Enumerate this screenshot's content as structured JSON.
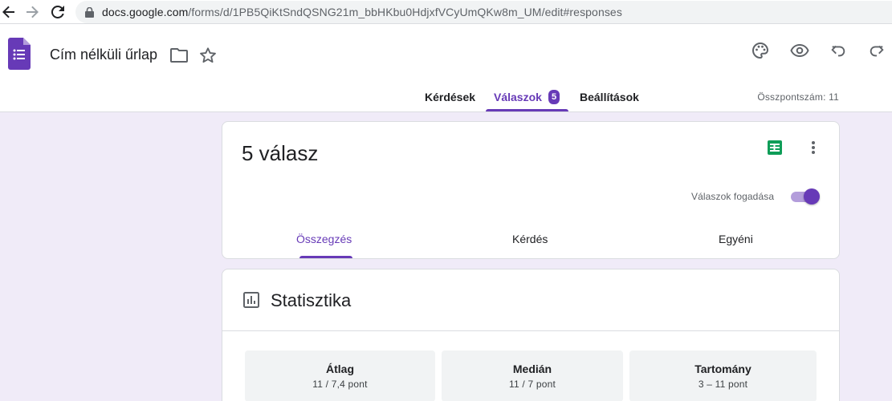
{
  "browser": {
    "url_host": "docs.google.com",
    "url_path": "/forms/d/1PB5QiKtSndQSNG21m_bbHKbu0HdjxfVCyUmQKw8m_UM/edit#responses"
  },
  "header": {
    "title": "Cím nélküli űrlap",
    "icons": [
      "forms-logo-icon",
      "folder-icon",
      "star-icon",
      "palette-icon",
      "eye-icon",
      "undo-icon",
      "redo-icon"
    ]
  },
  "tabs": {
    "questions": "Kérdések",
    "responses": "Válaszok",
    "responses_badge": "5",
    "settings": "Beállítások",
    "total_points": "Összpontszám: 11"
  },
  "responses_card": {
    "count_label": "5 válasz",
    "accepting_label": "Válaszok fogadása",
    "accepting": true,
    "subtabs": [
      "Összegzés",
      "Kérdés",
      "Egyéni"
    ]
  },
  "stats": {
    "title": "Statisztika",
    "items": [
      {
        "label": "Átlag",
        "value": "11 / 7,4 pont"
      },
      {
        "label": "Medián",
        "value": "11 / 7 pont"
      },
      {
        "label": "Tartomány",
        "value": "3 – 11 pont"
      }
    ]
  },
  "colors": {
    "accent": "#673ab7",
    "background": "#f0ebf8",
    "sheets_green": "#0f9d58"
  }
}
